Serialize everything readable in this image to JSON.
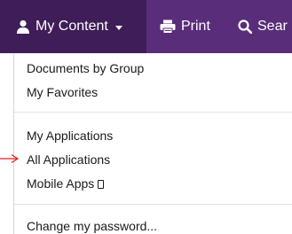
{
  "navbar": {
    "my_content": {
      "label": "My Content",
      "icon": "user-icon"
    },
    "print": {
      "label": "Print",
      "icon": "printer-icon"
    },
    "search": {
      "label": "Sear",
      "icon": "search-icon"
    },
    "colors": {
      "bar": "#5a2d7a",
      "active": "#3f1d58"
    }
  },
  "menu": {
    "groups": [
      {
        "items": [
          "Documents by Group",
          "My Favorites"
        ]
      },
      {
        "items": [
          "My Applications",
          "All Applications",
          "Mobile Apps"
        ]
      },
      {
        "items": [
          "Change my password..."
        ]
      }
    ]
  },
  "annotation": {
    "arrow_color": "#e0201a",
    "points_to": "All Applications"
  }
}
